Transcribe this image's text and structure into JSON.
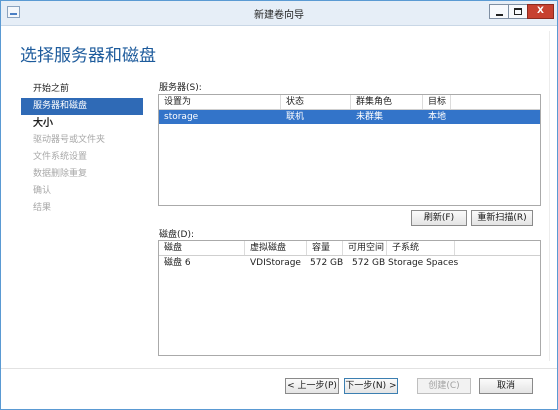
{
  "window": {
    "title": "新建卷向导",
    "min_glyph": "",
    "max_glyph": "",
    "close_glyph": "X"
  },
  "page_title": "选择服务器和磁盘",
  "steps": [
    {
      "label": "开始之前",
      "state": "normal"
    },
    {
      "label": "服务器和磁盘",
      "state": "active"
    },
    {
      "label": "大小",
      "state": "bold"
    },
    {
      "label": "驱动器号或文件夹",
      "state": "disabled"
    },
    {
      "label": "文件系统设置",
      "state": "disabled"
    },
    {
      "label": "数据删除重复",
      "state": "disabled"
    },
    {
      "label": "确认",
      "state": "disabled"
    },
    {
      "label": "结果",
      "state": "disabled"
    }
  ],
  "servers": {
    "label": "服务器(S):",
    "columns": [
      "设置为",
      "状态",
      "群集角色",
      "目标"
    ],
    "rows": [
      [
        "storage",
        "联机",
        "未群集",
        "本地"
      ]
    ]
  },
  "buttons": {
    "refresh": "刷新(F)",
    "rescan": "重新扫描(R)",
    "prev": "< 上一步(P)",
    "next": "下一步(N) >",
    "create": "创建(C)",
    "cancel": "取消"
  },
  "disks": {
    "label": "磁盘(D):",
    "columns": [
      "磁盘",
      "虚拟磁盘",
      "容量",
      "可用空间",
      "子系统"
    ],
    "rows": [
      [
        "磁盘 6",
        "VDIStorage",
        "572 GB",
        "572 GB",
        "Storage Spaces"
      ]
    ]
  }
}
